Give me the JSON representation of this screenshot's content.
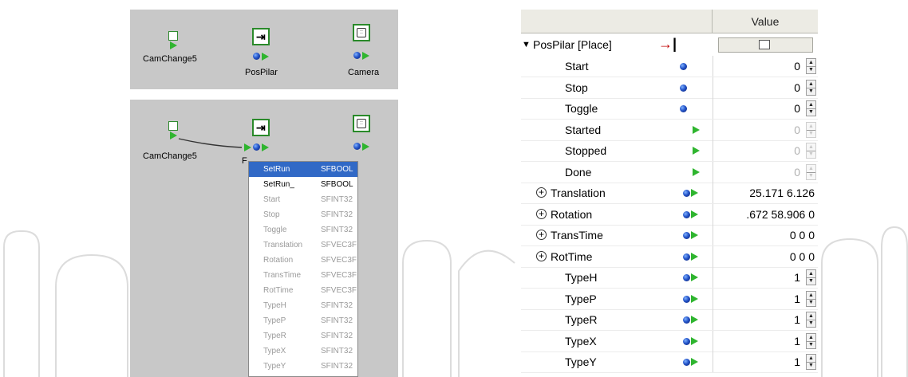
{
  "colors": {
    "panel": "#c8c8c8",
    "selection": "#3169c6",
    "node_border": "#2a8a2a",
    "event_out": "#2fb52f",
    "field_dot": "#2454c8"
  },
  "scene_top": {
    "nodes": [
      {
        "label": "CamChange5",
        "icon": "sensor-square-icon"
      },
      {
        "label": "PosPilar",
        "icon": "place-arrow-icon"
      },
      {
        "label": "Camera",
        "icon": "camera-icon"
      }
    ]
  },
  "scene_bottom": {
    "nodes": [
      {
        "label": "CamChange5",
        "icon": "sensor-square-icon"
      },
      {
        "label": "F",
        "icon": "place-arrow-icon"
      },
      {
        "label": "",
        "icon": "camera-icon"
      }
    ],
    "menu": [
      {
        "name": "SetRun",
        "type": "SFBOOL",
        "state": "selected"
      },
      {
        "name": "SetRun_",
        "type": "SFBOOL",
        "state": "enabled"
      },
      {
        "name": "Start",
        "type": "SFINT32",
        "state": "disabled"
      },
      {
        "name": "Stop",
        "type": "SFINT32",
        "state": "disabled"
      },
      {
        "name": "Toggle",
        "type": "SFINT32",
        "state": "disabled"
      },
      {
        "name": "Translation",
        "type": "SFVEC3F",
        "state": "disabled"
      },
      {
        "name": "Rotation",
        "type": "SFVEC3F",
        "state": "disabled"
      },
      {
        "name": "TransTime",
        "type": "SFVEC3F",
        "state": "disabled"
      },
      {
        "name": "RotTime",
        "type": "SFVEC3F",
        "state": "disabled"
      },
      {
        "name": "TypeH",
        "type": "SFINT32",
        "state": "disabled"
      },
      {
        "name": "TypeP",
        "type": "SFINT32",
        "state": "disabled"
      },
      {
        "name": "TypeR",
        "type": "SFINT32",
        "state": "disabled"
      },
      {
        "name": "TypeX",
        "type": "SFINT32",
        "state": "disabled"
      },
      {
        "name": "TypeY",
        "type": "SFINT32",
        "state": "disabled"
      }
    ]
  },
  "properties": {
    "header_value": "Value",
    "node_title": "PosPilar [Place]",
    "rows": [
      {
        "name": "Start",
        "io": "in",
        "value": "0",
        "kind": "spin",
        "dim": false
      },
      {
        "name": "Stop",
        "io": "in",
        "value": "0",
        "kind": "spin",
        "dim": false
      },
      {
        "name": "Toggle",
        "io": "in",
        "value": "0",
        "kind": "spin",
        "dim": false
      },
      {
        "name": "Started",
        "io": "out",
        "value": "0",
        "kind": "spin",
        "dim": true
      },
      {
        "name": "Stopped",
        "io": "out",
        "value": "0",
        "kind": "spin",
        "dim": true
      },
      {
        "name": "Done",
        "io": "out",
        "value": "0",
        "kind": "spin",
        "dim": true
      },
      {
        "name": "Translation",
        "io": "both",
        "value": "25.171 6.126",
        "kind": "text",
        "expand": true
      },
      {
        "name": "Rotation",
        "io": "both",
        "value": ".672 58.906 0",
        "kind": "text",
        "expand": true
      },
      {
        "name": "TransTime",
        "io": "both",
        "value": "0 0 0",
        "kind": "text",
        "expand": true
      },
      {
        "name": "RotTime",
        "io": "both",
        "value": "0 0 0",
        "kind": "text",
        "expand": true
      },
      {
        "name": "TypeH",
        "io": "both",
        "value": "1",
        "kind": "spin",
        "dim": false
      },
      {
        "name": "TypeP",
        "io": "both",
        "value": "1",
        "kind": "spin",
        "dim": false
      },
      {
        "name": "TypeR",
        "io": "both",
        "value": "1",
        "kind": "spin",
        "dim": false
      },
      {
        "name": "TypeX",
        "io": "both",
        "value": "1",
        "kind": "spin",
        "dim": false
      },
      {
        "name": "TypeY",
        "io": "both",
        "value": "1",
        "kind": "spin",
        "dim": false
      }
    ]
  }
}
